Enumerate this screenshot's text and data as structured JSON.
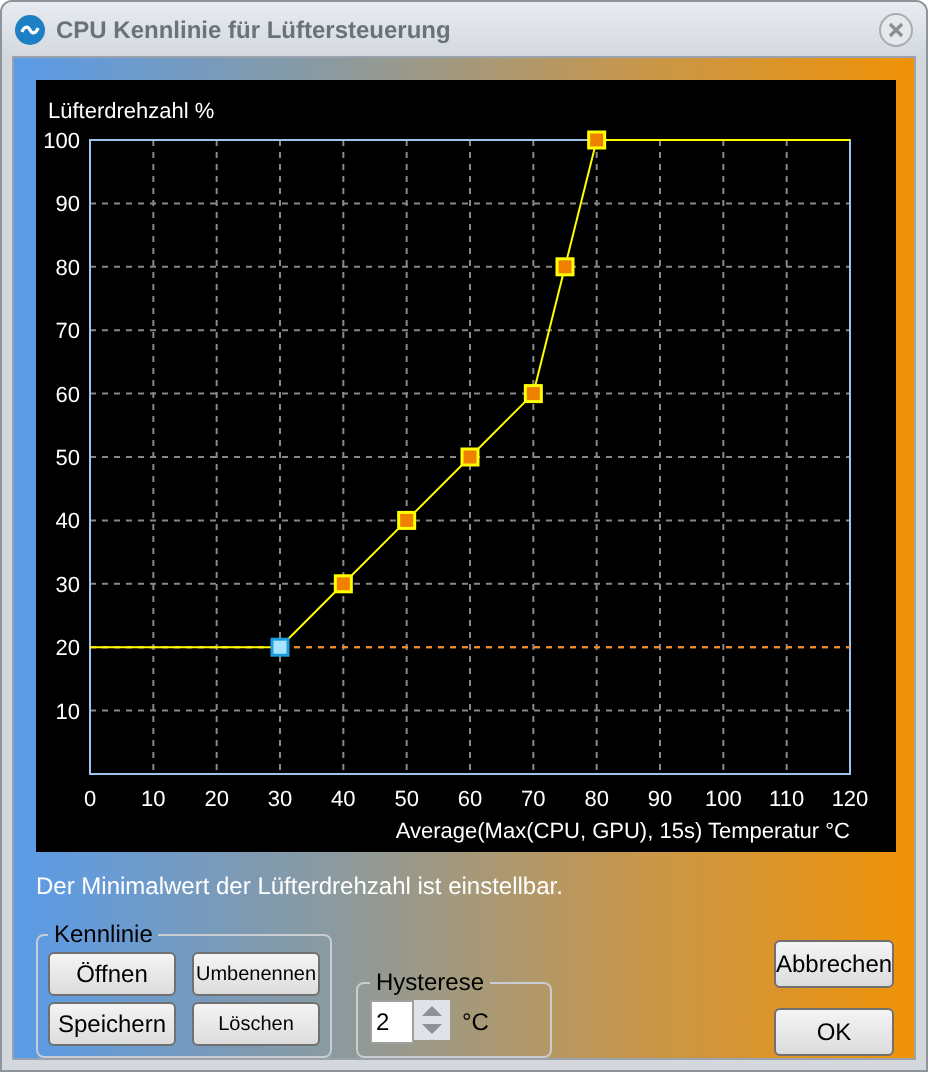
{
  "window": {
    "title": "CPU Kennlinie für Lüftersteuerung"
  },
  "chart": {
    "chart_data": {
      "type": "line",
      "ylabel": "Lüfterdrehzahl %",
      "xlabel": "Average(Max(CPU, GPU), 15s) Temperatur °C",
      "x": [
        0,
        30,
        40,
        50,
        60,
        70,
        75,
        80,
        120
      ],
      "series": [
        {
          "color": "#ffff00",
          "values": [
            20,
            20,
            30,
            40,
            50,
            60,
            80,
            100,
            100
          ]
        }
      ],
      "grid": true,
      "xlim": [
        0,
        120
      ],
      "ylim": [
        0,
        100
      ],
      "xticks": [
        0,
        10,
        20,
        30,
        40,
        50,
        60,
        70,
        80,
        90,
        100,
        110,
        120
      ],
      "yticks": [
        10,
        20,
        30,
        40,
        50,
        60,
        70,
        80,
        90,
        100
      ],
      "ref_lines": [
        {
          "axis": "y",
          "value": 20,
          "color": "#ff8c1a"
        }
      ]
    }
  },
  "hint": "Der Minimalwert der Lüfterdrehzahl ist einstellbar.",
  "kennlinie": {
    "title": "Kennlinie",
    "buttons": [
      "Öffnen",
      "Umbenennen",
      "Speichern",
      "Löschen"
    ]
  },
  "hysterese": {
    "title": "Hysterese",
    "value": "2",
    "unit": "°C"
  },
  "buttons": [
    "Abbrechen",
    "OK"
  ]
}
